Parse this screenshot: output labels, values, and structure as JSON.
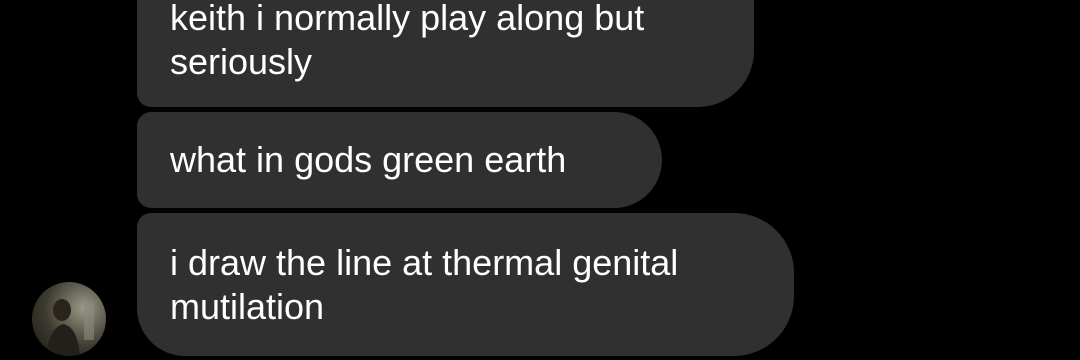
{
  "messages": [
    {
      "lines": [
        "keith i normally play along but",
        "seriously"
      ]
    },
    {
      "lines": [
        "what in gods green earth"
      ]
    },
    {
      "lines": [
        "i draw the line at thermal genital",
        "mutilation"
      ]
    }
  ],
  "colors": {
    "background": "#000000",
    "bubble": "#303030",
    "text": "#ffffff"
  },
  "avatar": {
    "icon": "profile-photo-avatar"
  }
}
